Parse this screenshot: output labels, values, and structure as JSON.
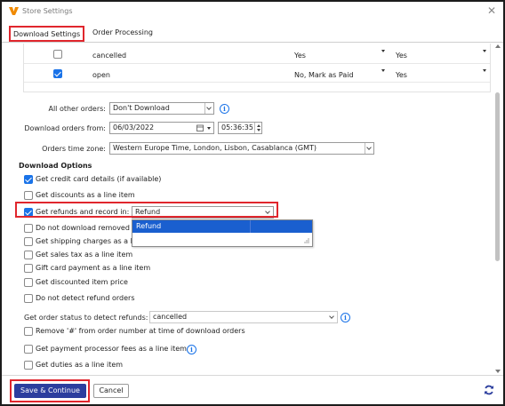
{
  "window": {
    "title": "Store Settings",
    "close_glyph": "✕"
  },
  "colors": {
    "accent": "#1a73e8",
    "primary_button": "#2c3e9e",
    "highlight": "#e0262d",
    "selection": "#1a5fcf",
    "app_icon": "#f08a00"
  },
  "tabs": [
    {
      "label": "Download Settings",
      "active": true
    },
    {
      "label": "Order Processing",
      "active": false
    }
  ],
  "status_rows": [
    {
      "checked": false,
      "status": "cancelled",
      "download": "Yes",
      "notify": "Yes"
    },
    {
      "checked": true,
      "status": "open",
      "download": "No, Mark as Paid",
      "notify": "Yes"
    }
  ],
  "form": {
    "other_orders": {
      "label": "All other orders:",
      "value": "Don't Download",
      "info_icon": "info-icon"
    },
    "download_from": {
      "label": "Download orders from:",
      "date": "06/03/2022",
      "time": "05:36:35"
    },
    "time_zone": {
      "label": "Orders time zone:",
      "value": "Western Europe Time, London, Lisbon, Casablanca (GMT)"
    }
  },
  "download_options": {
    "heading": "Download Options",
    "items": [
      {
        "label": "Get credit card details (if available)",
        "checked": true
      },
      {
        "label": "Get discounts as a line item",
        "checked": false
      },
      {
        "label": "Get refunds and record in:",
        "checked": true
      },
      {
        "label": "Do not download removed i",
        "checked": false
      },
      {
        "label": "Get shipping charges as a li",
        "checked": false
      },
      {
        "label": "Get sales tax as a line item",
        "checked": false
      },
      {
        "label": "Gift card payment as a line item",
        "checked": false
      },
      {
        "label": "Get discounted item price",
        "checked": false
      },
      {
        "label": "Do not detect refund orders",
        "checked": false
      }
    ],
    "refund_select": {
      "value": "Refund",
      "options": [
        "Refund"
      ]
    }
  },
  "refund_status": {
    "label": "Get order status to detect refunds:",
    "value": "cancelled"
  },
  "more_options": [
    {
      "label": "Remove '#' from order number at time of download orders",
      "checked": false
    },
    {
      "label": "Get payment processor fees as a line item",
      "checked": false
    },
    {
      "label": "Get duties as a line item",
      "checked": false
    }
  ],
  "footer": {
    "save_label": "Save & Continue",
    "cancel_label": "Cancel",
    "refresh_icon": "refresh-icon"
  }
}
